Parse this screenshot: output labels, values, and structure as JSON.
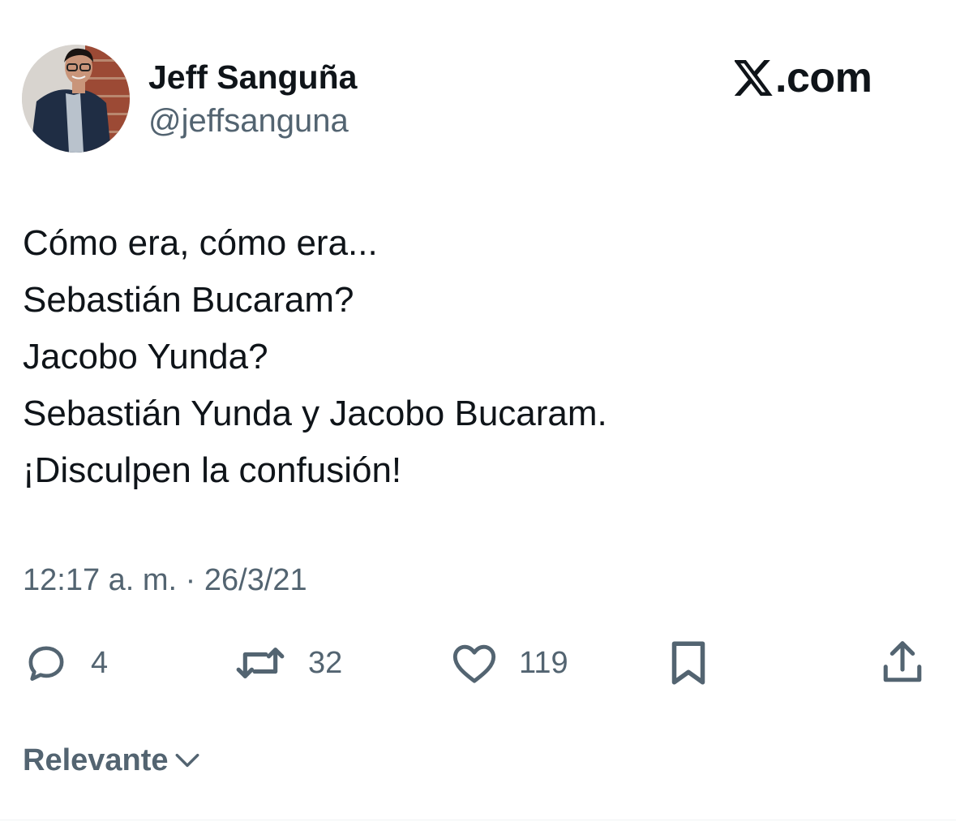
{
  "author": {
    "display_name": "Jeff Sanguña",
    "handle": "@jeffsanguna"
  },
  "brand": {
    "icon": "x-logo-icon",
    "text": ".com"
  },
  "tweet": {
    "lines": [
      "Cómo era, cómo era...",
      "Sebastián Bucaram?",
      "Jacobo Yunda?",
      "Sebastián Yunda y Jacobo Bucaram.",
      "¡Disculpen la confusión!"
    ],
    "timestamp": "12:17 a. m. · 26/3/21"
  },
  "actions": {
    "reply": {
      "icon": "reply-icon",
      "count": "4"
    },
    "retweet": {
      "icon": "retweet-icon",
      "count": "32"
    },
    "like": {
      "icon": "heart-icon",
      "count": "119"
    },
    "bookmark": {
      "icon": "bookmark-icon"
    },
    "share": {
      "icon": "share-icon"
    }
  },
  "sort": {
    "label": "Relevante",
    "icon": "chevron-down-icon"
  },
  "colors": {
    "text": "#0f1419",
    "secondary": "#536471"
  }
}
